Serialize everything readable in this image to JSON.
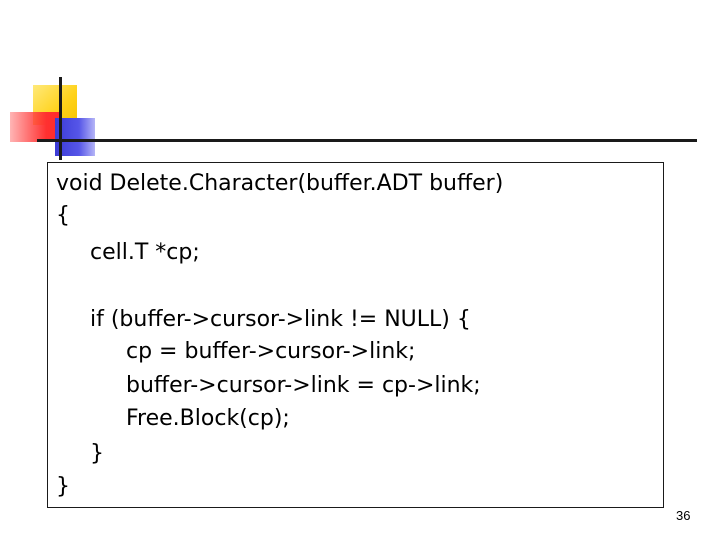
{
  "code": {
    "lines": [
      "void Delete.Character(buffer.ADT buffer)",
      "{",
      "cell.T *cp;",
      "if (buffer->cursor->link != NULL) {",
      "cp = buffer->cursor->link;",
      "buffer->cursor->link = cp->link;",
      "Free.Block(cp);",
      "}",
      "}"
    ]
  },
  "footer": {
    "page_number": "36"
  },
  "colors": {
    "logo_yellow": "#ffd21a",
    "logo_red": "#ff3030",
    "logo_blue": "#4a4ae0",
    "rule": "#1a1a1a"
  }
}
